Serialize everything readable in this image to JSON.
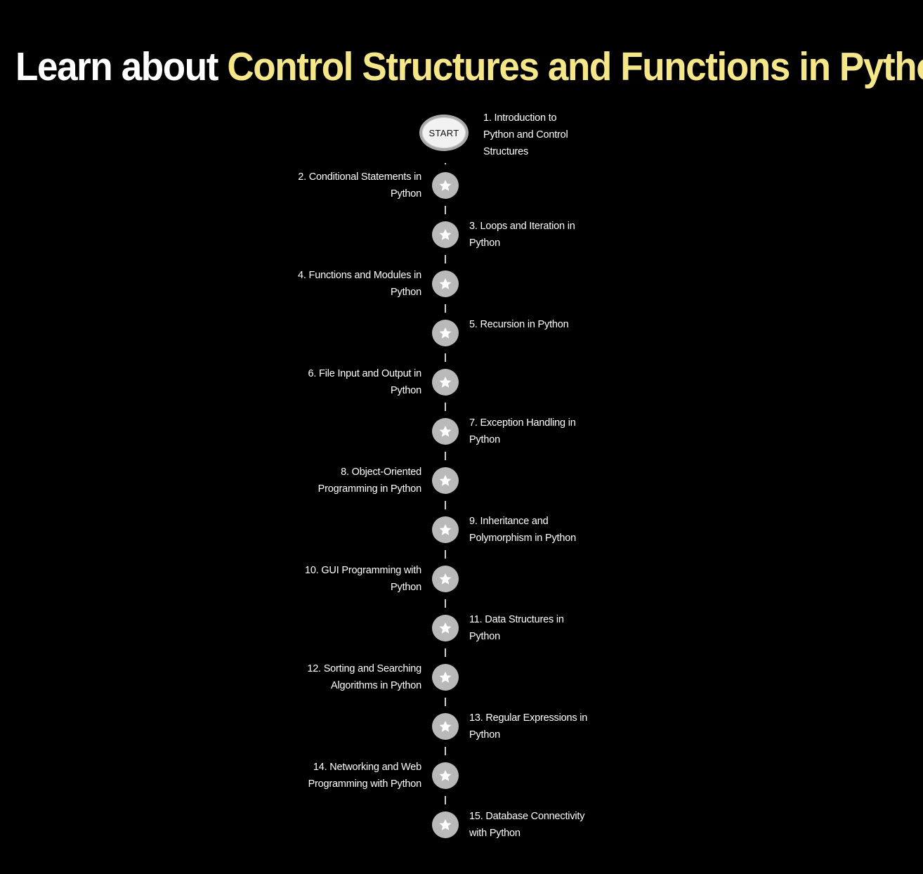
{
  "header": {
    "title_lead": "Learn about ",
    "title_topic": "Control Structures and Functions in Python",
    "topic_color": "#f5e68a"
  },
  "roadmap": {
    "start": {
      "label": "START",
      "step": "1. Introduction to Python and Control Structures"
    },
    "steps": [
      {
        "label": "2. Conditional Statements in Python",
        "side": "left",
        "icon": "star-icon"
      },
      {
        "label": "3. Loops and Iteration in Python",
        "side": "right",
        "icon": "star-icon"
      },
      {
        "label": "4. Functions and Modules in Python",
        "side": "left",
        "icon": "star-icon"
      },
      {
        "label": "5. Recursion in Python",
        "side": "right",
        "icon": "star-icon"
      },
      {
        "label": "6. File Input and Output in Python",
        "side": "left",
        "icon": "star-icon"
      },
      {
        "label": "7. Exception Handling in Python",
        "side": "right",
        "icon": "star-icon"
      },
      {
        "label": "8. Object-Oriented Programming in Python",
        "side": "left",
        "icon": "star-icon"
      },
      {
        "label": "9. Inheritance and Polymorphism in Python",
        "side": "right",
        "icon": "star-icon"
      },
      {
        "label": "10. GUI Programming with Python",
        "side": "left",
        "icon": "star-icon"
      },
      {
        "label": "11. Data Structures in Python",
        "side": "right",
        "icon": "star-icon"
      },
      {
        "label": "12. Sorting and Searching Algorithms in Python",
        "side": "left",
        "icon": "star-icon"
      },
      {
        "label": "13. Regular Expressions in Python",
        "side": "right",
        "icon": "star-icon"
      },
      {
        "label": "14. Networking and Web Programming with Python",
        "side": "left",
        "icon": "star-icon"
      },
      {
        "label": "15. Database Connectivity with Python",
        "side": "right",
        "icon": "star-icon"
      }
    ]
  }
}
